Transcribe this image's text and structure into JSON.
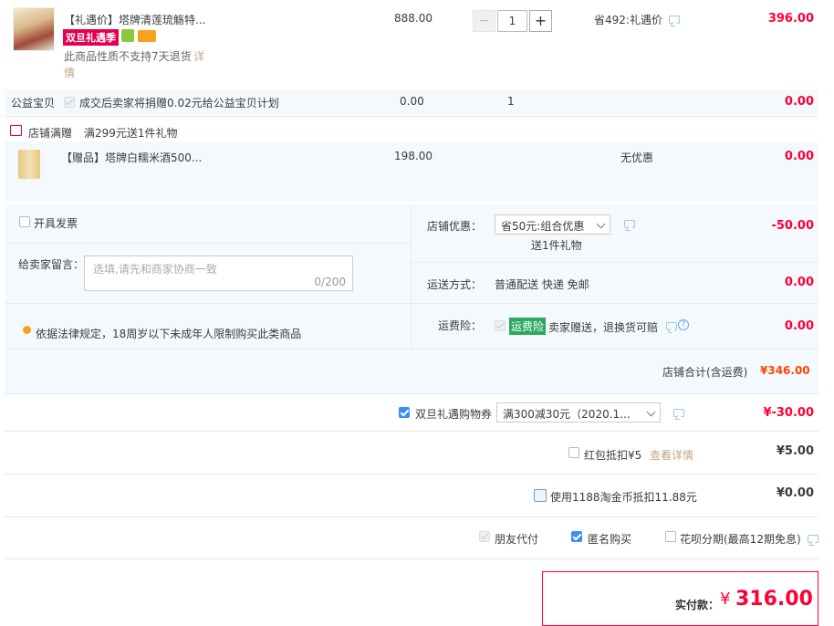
{
  "item1": {
    "title": "【礼遇价】塔牌清莲琉觞特...",
    "badge_promo": "双旦礼遇季",
    "return_note": "此商品性质不支持7天退货",
    "detail_link_1": "详",
    "detail_link_2": "情",
    "unit_price": "888.00",
    "quantity": "1",
    "discount_info": "省492:礼遇价",
    "total": "396.00",
    "minus": "−",
    "plus": "+"
  },
  "charity": {
    "label": "公益宝贝",
    "text": "成交后卖家将捐赠0.02元给公益宝贝计划",
    "price": "0.00",
    "quantity": "1",
    "total": "0.00"
  },
  "gift_section": {
    "title": "店铺满赠",
    "rule": "满299元送1件礼物"
  },
  "gift_item": {
    "title": "【赠品】塔牌白糯米酒500...",
    "price": "198.00",
    "discount": "无优惠",
    "total": "0.00"
  },
  "order_left": {
    "invoice_label": "开具发票",
    "message_label": "给卖家留言：",
    "message_placeholder": "选填,请先和商家协商一致",
    "message_counter": "0/200",
    "legal_note": "依据法律规定，18周岁以下未成年人限制购买此类商品"
  },
  "order_right": {
    "shop_discount_label": "店铺优惠：",
    "shop_discount_value": "省50元:组合优惠",
    "shop_discount_sub": "送1件礼物",
    "shop_discount_amount": "-50.00",
    "shipping_label": "运送方式：",
    "shipping_value": "普通配送 快递 免邮",
    "shipping_amount": "0.00",
    "insurance_label": "运费险：",
    "insurance_badge": "运费险",
    "insurance_text": "卖家赠送，退换货可赔",
    "insurance_amount": "0.00"
  },
  "shop_total": {
    "label": "店铺合计(含运费)",
    "amount": "¥346.00"
  },
  "coupon": {
    "label": "双旦礼遇购物券",
    "select_value": "满300减30元（2020.1...",
    "amount": "¥-30.00"
  },
  "redpacket": {
    "label": "红包抵扣¥5",
    "link": "查看详情",
    "amount": "¥5.00"
  },
  "taojinbi": {
    "label": "使用1188淘金币抵扣11.88元",
    "amount": "¥0.00"
  },
  "pay_options": {
    "friend_pay": "朋友代付",
    "anonymous": "匿名购买",
    "installment": "花呗分期(最高12期免息)"
  },
  "final": {
    "label": "实付款：",
    "currency": "¥",
    "amount": "316.00"
  },
  "colors": {
    "accent_red": "#ff0036",
    "brand_orange": "#f40",
    "checkbox_blue": "#3c8ef5",
    "insurance_green": "#2ea860",
    "promo_red": "#e5004f"
  }
}
